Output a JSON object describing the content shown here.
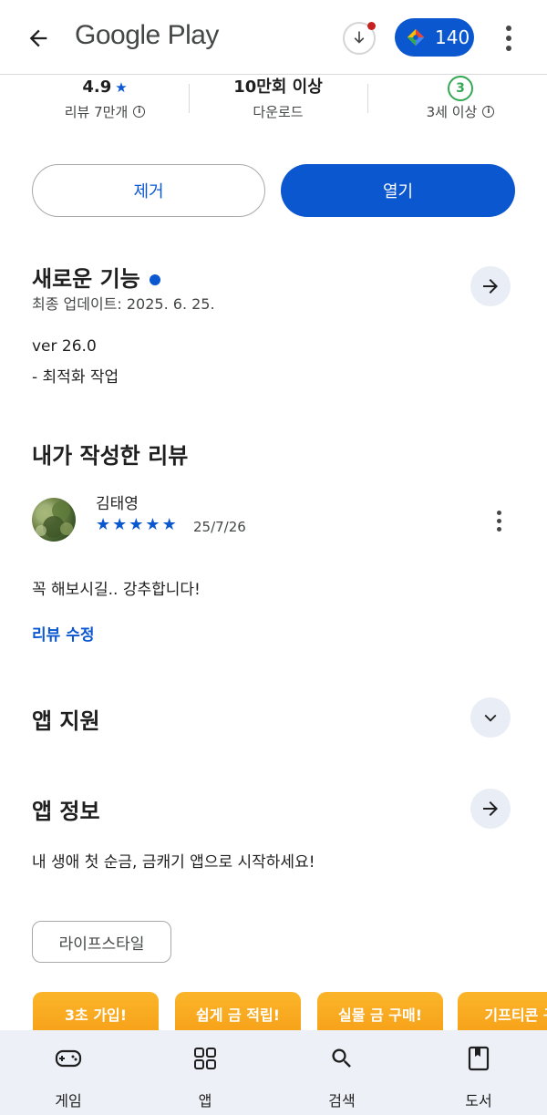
{
  "topbar": {
    "brand": "Google Play",
    "points": "140"
  },
  "stats": {
    "rating": "4.9",
    "rating_label": "리뷰 7만개",
    "downloads": "10만회 이상",
    "downloads_label": "다운로드",
    "age_badge": "3",
    "age_label": "3세 이상"
  },
  "actions": {
    "remove": "제거",
    "open": "열기"
  },
  "whats_new": {
    "title": "새로운 기능",
    "updated": "최종 업데이트: 2025. 6. 25.",
    "line1": "ver 26.0",
    "line2": "- 최적화 작업"
  },
  "my_review": {
    "title": "내가 작성한 리뷰",
    "author": "김태영",
    "date": "25/7/26",
    "stars": 5,
    "text": "꼭 해보시길.. 강추합니다!",
    "edit": "리뷰 수정"
  },
  "app_support": {
    "title": "앱 지원"
  },
  "app_info": {
    "title": "앱 정보",
    "description": "내 생애 첫 순금, 금캐기 앱으로 시작하세요!",
    "category": "라이프스타일"
  },
  "screenshots": [
    "3초 가입!",
    "쉽게 금 적립!",
    "실물 금 구매!",
    "기프티콘 구"
  ],
  "bottom_nav": {
    "games": "게임",
    "apps": "앱",
    "search": "검색",
    "books": "도서"
  },
  "colors": {
    "accent": "#0b57d0",
    "badge_green": "#34a853",
    "notify_red": "#c5221f"
  }
}
